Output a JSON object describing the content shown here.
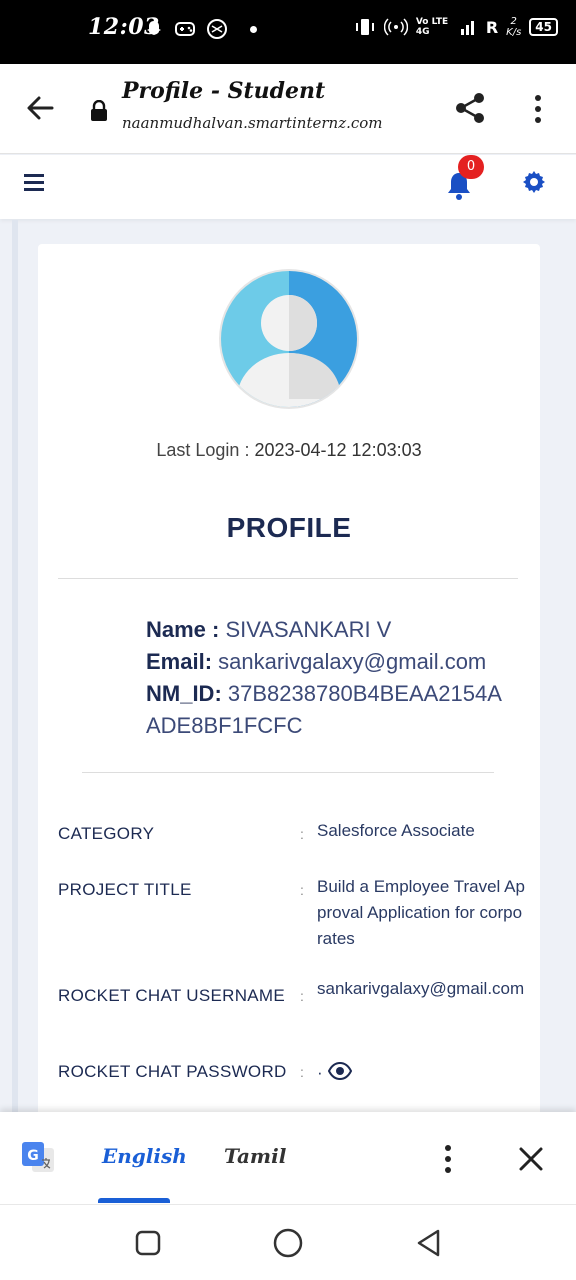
{
  "status_bar": {
    "time": "12:03",
    "network": "Vo LTE 4G",
    "roaming": "R",
    "speed": "2",
    "speed_unit": "K/s",
    "battery": "45"
  },
  "browser": {
    "title": "Profile - Student",
    "url": "naanmudhalvan.smartinternz.com"
  },
  "toolbar": {
    "notification_count": "0"
  },
  "profile": {
    "last_login_label": "Last Login :",
    "last_login_value": "2023-04-12 12:03:03",
    "heading": "PROFILE",
    "name_label": "Name :",
    "name_value": "SIVASANKARI V",
    "email_label": "Email:",
    "email_value": "sankarivgalaxy@gmail.com",
    "nmid_label": "NM_ID:",
    "nmid_value": "37B8238780B4BEAA2154AADE8BF1FCFC"
  },
  "details": [
    {
      "label": "CATEGORY",
      "value": "Salesforce Associate"
    },
    {
      "label": "PROJECT TITLE",
      "value": "Build a Employee Travel Approval Application for corporates"
    },
    {
      "label": "ROCKET CHAT USERNAME",
      "value": "sankarivgalaxy@gmail.com"
    },
    {
      "label": "ROCKET CHAT PASSWORD",
      "value": "·"
    }
  ],
  "details_separator": ":",
  "translate_bar": {
    "lang_selected": "English",
    "lang_other": "Tamil"
  },
  "colors": {
    "primary_text": "#1c2a52",
    "accent": "#1a5fd6",
    "badge": "#e42121"
  }
}
